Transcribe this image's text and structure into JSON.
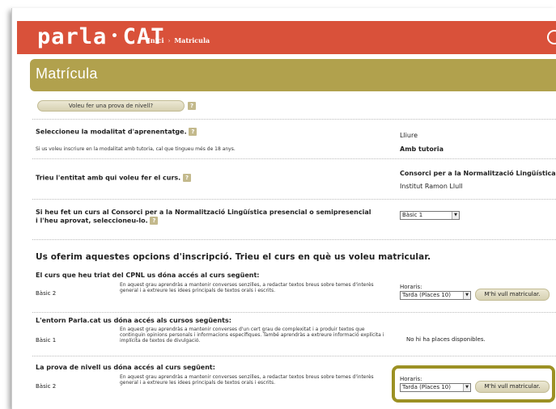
{
  "header": {
    "logo_main": "parla",
    "logo_dot": "•",
    "logo_suffix": "CAT",
    "crumb_home": "Inici",
    "crumb_sep": "›",
    "crumb_current": "Matricula"
  },
  "page_title": "Matrícula",
  "level_test_button": "Voleu fer una prova de nivell?",
  "help_glyph": "?",
  "modality": {
    "question": "Seleccioneu la modalitat d'aprenentatge.",
    "note": "Si us voleu inscriure en la modalitat amb tutoria, cal que tingueu més de 18 anys.",
    "options": [
      "Lliure",
      "Amb tutoria"
    ]
  },
  "entity": {
    "question": "Trieu l'entitat amb qui voleu fer el curs.",
    "options": [
      "Consorci per a la Normalització Lingüística",
      "Institut Ramon Llull"
    ]
  },
  "previous_course": {
    "question_line1": "Si heu fet un curs al Consorci per a la Normalització Lingüística presencial o semipresencial",
    "question_line2": "i l'heu aprovat, seleccioneu-lo.",
    "select_value": "Bàsic 1"
  },
  "offers_title": "Us oferim aquestes opcions d'inscripció. Trieu el curs en què us voleu matricular.",
  "groups": [
    {
      "heading": "El curs que heu triat del CPNL us dóna accés al curs següent:",
      "level": "Bàsic 2",
      "description": "En aquest grau aprendràs a mantenir converses senzilles, a redactar textos breus sobre temes d'interès general i a extreure les idees principals de textos orals i escrits.",
      "schedule_label": "Horaris:",
      "schedule_value": "Tarda  (Places 10)",
      "enrol_button": "M'hi vull matricular."
    },
    {
      "heading": "L'entorn Parla.cat us dóna accés als cursos següents:",
      "level": "Bàsic 1",
      "description": "En aquest grau aprendràs a mantenir converses d'un cert grau de complexitat i a produir textos que continguin opinions personals i informacions específiques. També aprendràs a extreure informació explícita i implícita de textos de divulgació.",
      "no_places": "No hi ha places disponibles."
    },
    {
      "heading": "La prova de nivell us dóna accés al curs següent:",
      "level": "Bàsic 2",
      "description": "En aquest grau aprendràs a mantenir converses senzilles, a redactar textos breus sobre temes d'interès general i a extreure les idees principals de textos orals i escrits.",
      "schedule_label": "Horaris:",
      "schedule_value": "Tarda  (Places 10)",
      "enrol_button": "M'hi vull matricular."
    }
  ],
  "colors": {
    "header_red": "#d9513a",
    "title_olive": "#b1a14d",
    "highlight_border": "#9c9124"
  }
}
